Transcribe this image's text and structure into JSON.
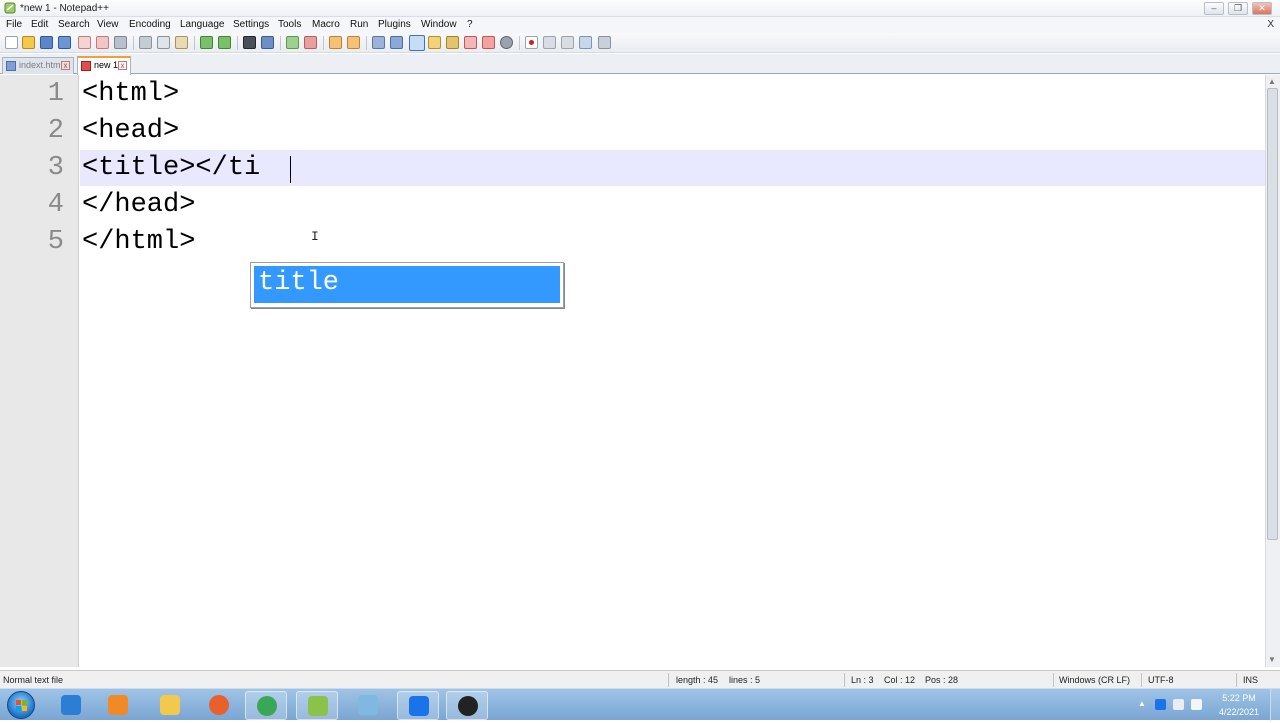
{
  "window": {
    "title": "*new 1 - Notepad++",
    "minimize_glyph": "–",
    "maximize_glyph": "❐",
    "close_glyph": "✕"
  },
  "menu": {
    "items": [
      "File",
      "Edit",
      "Search",
      "View",
      "Encoding",
      "Language",
      "Settings",
      "Tools",
      "Macro",
      "Run",
      "Plugins",
      "Window",
      "?"
    ],
    "close_doc_glyph": "X"
  },
  "tabs": [
    {
      "label": "indext.html",
      "active": false,
      "close_glyph": "x"
    },
    {
      "label": "new 1",
      "active": true,
      "close_glyph": "x"
    }
  ],
  "editor": {
    "line_numbers": [
      "1",
      "2",
      "3",
      "4",
      "5"
    ],
    "lines": [
      "<html>",
      "<head>",
      "<title></ti",
      "</head>",
      "</html>"
    ],
    "current_line": 3,
    "current_line_color": "#e8e8ff",
    "autocomplete": {
      "items": [
        "title"
      ],
      "selected_index": 0,
      "selection_color": "#3399ff"
    }
  },
  "status": {
    "file_type": "Normal text file",
    "length": "length : 45",
    "lines": "lines : 5",
    "ln": "Ln : 3",
    "col": "Col : 12",
    "pos": "Pos : 28",
    "eol": "Windows (CR LF)",
    "encoding": "UTF-8",
    "mode": "INS"
  },
  "taskbar": {
    "apps": [
      {
        "name": "internet-explorer-icon",
        "color": "#2a7fd4"
      },
      {
        "name": "media-player-icon",
        "color": "#f08a24"
      },
      {
        "name": "file-explorer-icon",
        "color": "#f2c94c"
      },
      {
        "name": "firefox-icon",
        "color": "#e8602c"
      },
      {
        "name": "chrome-icon",
        "color": "#3aa757"
      },
      {
        "name": "notepadpp-icon",
        "color": "#8bc34a"
      },
      {
        "name": "notepad-icon",
        "color": "#7fb8e0"
      },
      {
        "name": "uplay-icon",
        "color": "#1a73e8"
      },
      {
        "name": "obs-icon",
        "color": "#222222"
      }
    ],
    "tray_expand_glyph": "▲",
    "clock_time": "5:22 PM",
    "clock_date": "4/22/2021"
  }
}
